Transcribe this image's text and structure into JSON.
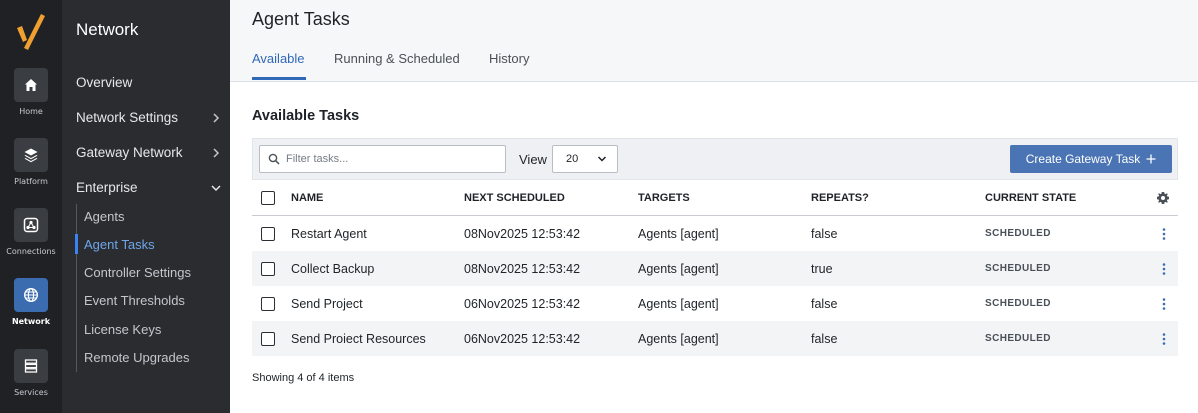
{
  "rail": {
    "items": [
      {
        "label": "Home",
        "icon": "home-icon"
      },
      {
        "label": "Platform",
        "icon": "layers-icon"
      },
      {
        "label": "Connections",
        "icon": "connections-icon"
      },
      {
        "label": "Network",
        "icon": "globe-icon",
        "active": true
      },
      {
        "label": "Services",
        "icon": "server-icon"
      }
    ]
  },
  "sidebar": {
    "title": "Network",
    "items": [
      {
        "label": "Overview"
      },
      {
        "label": "Network Settings",
        "chevron": "right"
      },
      {
        "label": "Gateway Network",
        "chevron": "right"
      },
      {
        "label": "Enterprise",
        "chevron": "down"
      }
    ],
    "subitems": [
      {
        "label": "Agents"
      },
      {
        "label": "Agent Tasks",
        "active": true
      },
      {
        "label": "Controller Settings"
      },
      {
        "label": "Event Thresholds"
      },
      {
        "label": "License Keys"
      },
      {
        "label": "Remote Upgrades"
      }
    ]
  },
  "header": {
    "title": "Agent Tasks",
    "tabs": [
      {
        "label": "Available",
        "active": true
      },
      {
        "label": "Running & Scheduled"
      },
      {
        "label": "History"
      }
    ]
  },
  "main": {
    "section_title": "Available Tasks",
    "filter_placeholder": "Filter tasks...",
    "view_label": "View",
    "view_value": "20",
    "create_button": "Create Gateway Task",
    "columns": [
      "NAME",
      "NEXT SCHEDULED",
      "TARGETS",
      "REPEATS?",
      "CURRENT STATE"
    ],
    "rows": [
      {
        "name": "Restart Agent",
        "next": "08Nov2025 12:53:42",
        "targets": "Agents [agent]",
        "repeats": "false",
        "state": "SCHEDULED"
      },
      {
        "name": "Collect Backup",
        "next": "08Nov2025 12:53:42",
        "targets": "Agents [agent]",
        "repeats": "true",
        "state": "SCHEDULED"
      },
      {
        "name": "Send Project",
        "next": "06Nov2025 12:53:42",
        "targets": "Agents [agent]",
        "repeats": "false",
        "state": "SCHEDULED"
      },
      {
        "name": "Send Proiect Resources",
        "next": "06Nov2025 12:53:42",
        "targets": "Agents [agent]",
        "repeats": "false",
        "state": "SCHEDULED"
      }
    ],
    "footer": "Showing 4 of 4 items"
  },
  "colors": {
    "accent": "#2f68b6",
    "button": "#4a74b4",
    "rail_bg": "#1f2125",
    "sidebar_bg": "#2a2c30",
    "logo": "#f0a030"
  }
}
